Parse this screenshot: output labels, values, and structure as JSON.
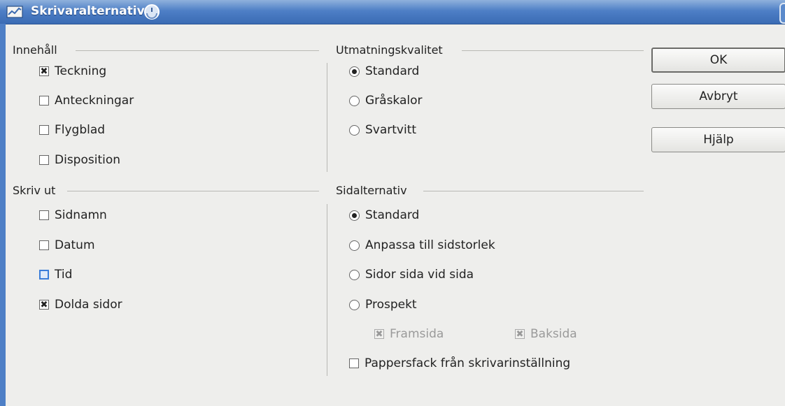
{
  "window": {
    "title": "Skrivaralternativ"
  },
  "contents": {
    "title": "Innehåll",
    "items": [
      {
        "label": "Teckning",
        "checked": true
      },
      {
        "label": "Anteckningar",
        "checked": false
      },
      {
        "label": "Flygblad",
        "checked": false
      },
      {
        "label": "Disposition",
        "checked": false
      }
    ]
  },
  "print": {
    "title": "Skriv ut",
    "items": [
      {
        "label": "Sidnamn",
        "checked": false
      },
      {
        "label": "Datum",
        "checked": false
      },
      {
        "label": "Tid",
        "checked": false,
        "focused": true
      },
      {
        "label": "Dolda sidor",
        "checked": true
      }
    ]
  },
  "quality": {
    "title": "Utmatningskvalitet",
    "items": [
      {
        "label": "Standard",
        "selected": true
      },
      {
        "label": "Gråskalor",
        "selected": false
      },
      {
        "label": "Svartvitt",
        "selected": false
      }
    ]
  },
  "page_options": {
    "title": "Sidalternativ",
    "items": [
      {
        "label": "Standard",
        "selected": true
      },
      {
        "label": "Anpassa till sidstorlek",
        "selected": false
      },
      {
        "label": "Sidor sida vid sida",
        "selected": false
      },
      {
        "label": "Prospekt",
        "selected": false
      }
    ],
    "sub": [
      {
        "label": "Framsida",
        "checked": true,
        "disabled": true
      },
      {
        "label": "Baksida",
        "checked": true,
        "disabled": true
      }
    ],
    "paper_tray": {
      "label": "Pappersfack från skrivarinställning",
      "checked": false
    }
  },
  "buttons": {
    "ok": "OK",
    "cancel": "Avbryt",
    "help": "Hjälp"
  }
}
